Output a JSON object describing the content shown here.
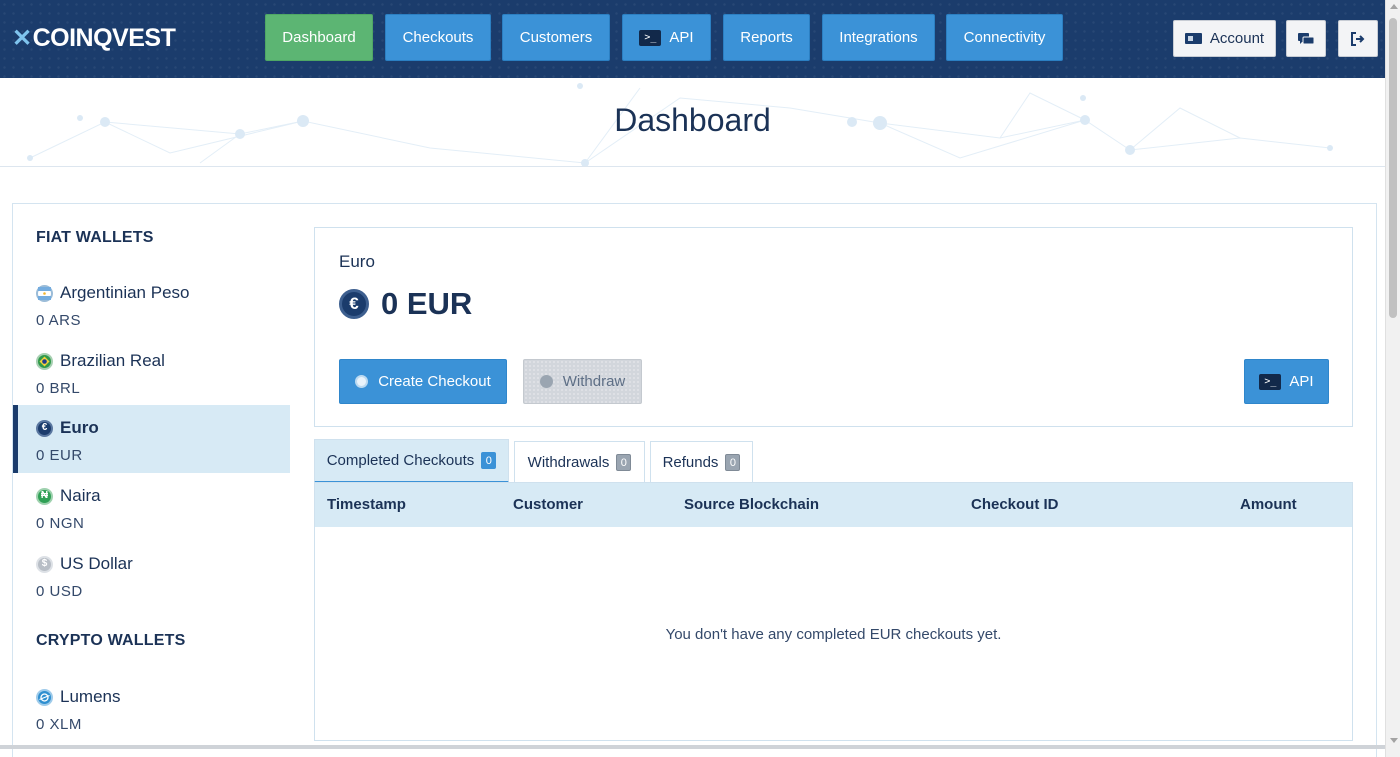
{
  "brand": {
    "name": "COINQVEST",
    "mark": "✕"
  },
  "nav": {
    "dashboard": "Dashboard",
    "checkouts": "Checkouts",
    "customers": "Customers",
    "api": "API",
    "reports": "Reports",
    "integrations": "Integrations",
    "connectivity": "Connectivity",
    "account": "Account"
  },
  "page": {
    "title": "Dashboard"
  },
  "sidebar": {
    "fiat_heading": "FIAT WALLETS",
    "crypto_heading": "CRYPTO WALLETS",
    "fiat": [
      {
        "name": "Argentinian Peso",
        "balance": "0 ARS",
        "icon": "argentina-flag-icon"
      },
      {
        "name": "Brazilian Real",
        "balance": "0 BRL",
        "icon": "brazil-flag-icon"
      },
      {
        "name": "Euro",
        "balance": "0 EUR",
        "icon": "euro-icon",
        "active": true
      },
      {
        "name": "Naira",
        "balance": "0 NGN",
        "icon": "naira-icon",
        "glyph": "₦"
      },
      {
        "name": "US Dollar",
        "balance": "0 USD",
        "icon": "dollar-icon"
      }
    ],
    "crypto": [
      {
        "name": "Lumens",
        "balance": "0 XLM",
        "icon": "stellar-icon"
      }
    ]
  },
  "wallet": {
    "label": "Euro",
    "amount": "0 EUR",
    "euro_glyph": "€",
    "create_checkout": "Create Checkout",
    "withdraw": "Withdraw",
    "api": "API"
  },
  "tabs": [
    {
      "label": "Completed Checkouts",
      "count": "0"
    },
    {
      "label": "Withdrawals",
      "count": "0"
    },
    {
      "label": "Refunds",
      "count": "0"
    }
  ],
  "table": {
    "columns": [
      "Timestamp",
      "Customer",
      "Source Blockchain",
      "Checkout ID",
      "Amount"
    ],
    "empty_message": "You don't have any completed EUR checkouts yet."
  },
  "colors": {
    "navbar": "#1b3c6c",
    "primary": "#3b92d7",
    "active_nav": "#5cb573",
    "active_row": "#d7eaf5"
  }
}
